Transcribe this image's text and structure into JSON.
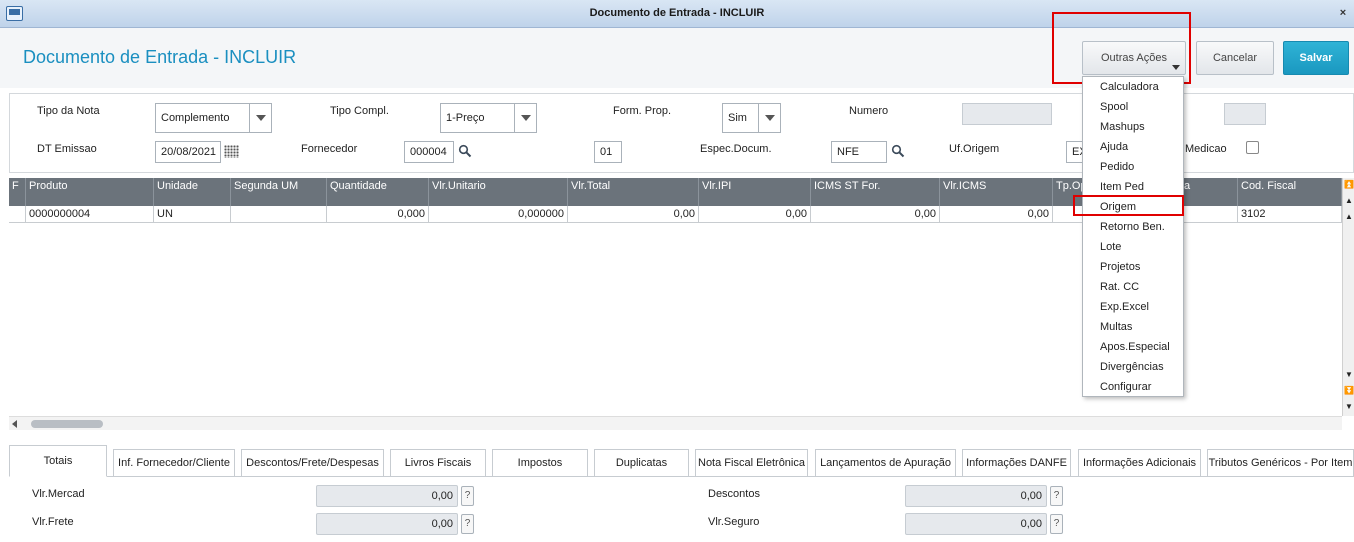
{
  "window": {
    "title": "Documento de Entrada - INCLUIR",
    "close_label": "×"
  },
  "header": {
    "page_title": "Documento de Entrada - INCLUIR",
    "outras_acoes_label": "Outras Ações",
    "cancelar_label": "Cancelar",
    "salvar_label": "Salvar"
  },
  "form": {
    "tipo_nota": {
      "label": "Tipo da Nota",
      "value": "Complemento"
    },
    "tipo_compl": {
      "label": "Tipo Compl.",
      "value": "1-Preço"
    },
    "form_prop": {
      "label": "Form. Prop.",
      "value": "Sim"
    },
    "numero": {
      "label": "Numero",
      "value": ""
    },
    "dt_emissao": {
      "label": "DT Emissao",
      "value": "20/08/2021"
    },
    "fornecedor": {
      "label": "Fornecedor",
      "value": "000004"
    },
    "loja": {
      "value": "01"
    },
    "espec_docum": {
      "label": "Espec.Docum.",
      "value": "NFE"
    },
    "uf_origem": {
      "label": "Uf.Origem",
      "value": "EX"
    },
    "medicao": {
      "label": "Medicao"
    }
  },
  "grid": {
    "columns": [
      "F",
      "Produto",
      "Unidade",
      "Segunda UM",
      "Quantidade",
      "Vlr.Unitario",
      "Vlr.Total",
      "Vlr.IPI",
      "ICMS ST For.",
      "Vlr.ICMS",
      "Tp.Op",
      "a",
      "Cod. Fiscal"
    ],
    "rows": [
      [
        "",
        "0000000004",
        "UN",
        "",
        "0,000",
        "0,000000",
        "0,00",
        "0,00",
        "0,00",
        "0,00",
        "",
        "",
        "3102"
      ]
    ]
  },
  "tabs": [
    "Totais",
    "Inf. Fornecedor/Cliente",
    "Descontos/Frete/Despesas",
    "Livros Fiscais",
    "Impostos",
    "Duplicatas",
    "Nota Fiscal Eletrônica",
    "Lançamentos de Apuração",
    "Informações DANFE",
    "Informações Adicionais",
    "Tributos Genéricos - Por Item"
  ],
  "totals": {
    "vlr_mercad": {
      "label": "Vlr.Mercad",
      "value": "0,00"
    },
    "vlr_frete": {
      "label": "Vlr.Frete",
      "value": "0,00"
    },
    "descontos": {
      "label": "Descontos",
      "value": "0,00"
    },
    "vlr_seguro": {
      "label": "Vlr.Seguro",
      "value": "0,00"
    },
    "help_label": "?"
  },
  "menu": {
    "items": [
      "Calculadora",
      "Spool",
      "Mashups",
      "Ajuda",
      "Pedido",
      "Item Ped",
      "Origem",
      "Retorno Ben.",
      "Lote",
      "Projetos",
      "Rat. CC",
      "Exp.Excel",
      "Multas",
      "Apos.Especial",
      "Divergências",
      "Configurar"
    ],
    "highlighted": "Origem"
  },
  "colors": {
    "accent": "#1a8fc0",
    "highlight_box": "#e00000",
    "grid_header": "#6b737b"
  }
}
